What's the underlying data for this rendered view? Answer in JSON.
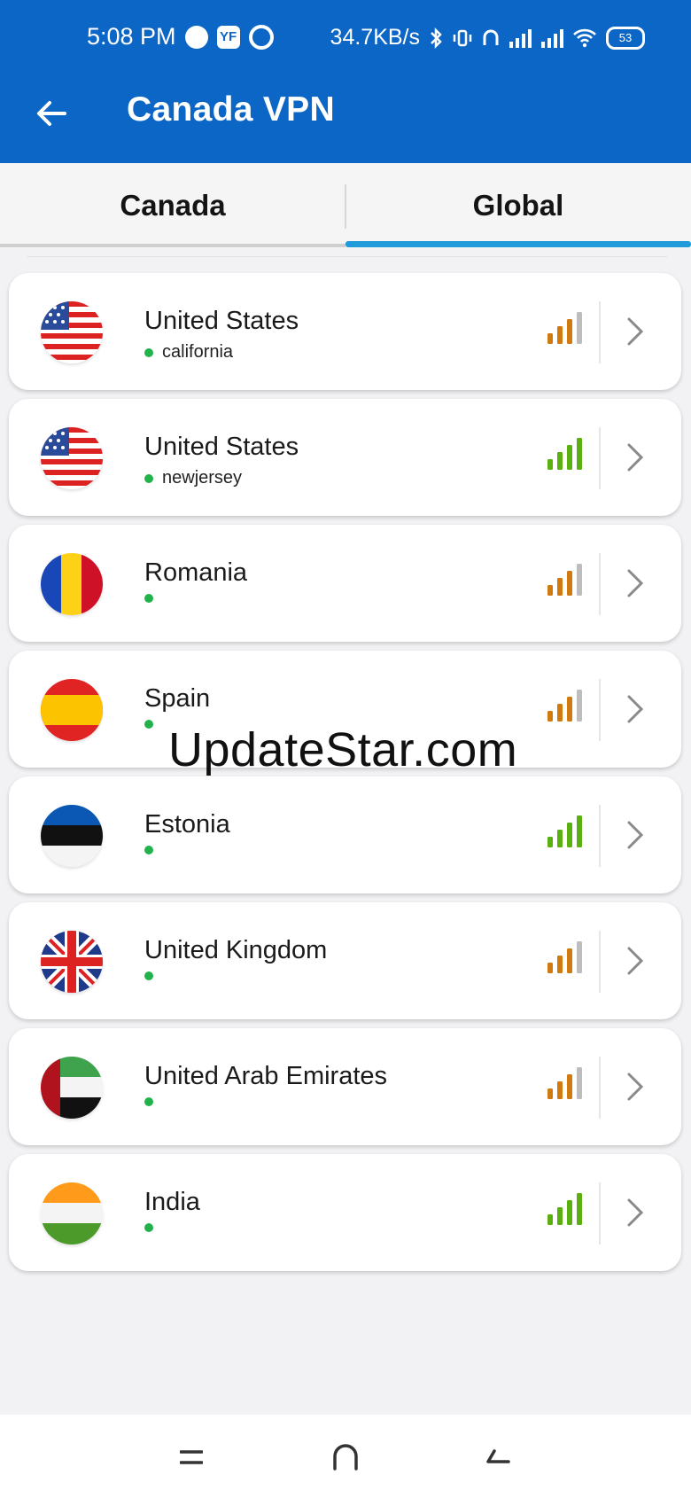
{
  "status_bar": {
    "time": "5:08 PM",
    "app_badge": "YF",
    "net_speed": "34.7KB/s",
    "battery": "53"
  },
  "app_bar": {
    "title": "Canada VPN"
  },
  "tabs": [
    {
      "label": "Canada",
      "active": false
    },
    {
      "label": "Global",
      "active": true
    }
  ],
  "servers": [
    {
      "country": "United States",
      "city": "california",
      "flag": "us-flag-icon",
      "signal_color": "#d07a10"
    },
    {
      "country": "United States",
      "city": "newjersey",
      "flag": "us-flag-icon",
      "signal_color": "#5ab00e"
    },
    {
      "country": "Romania",
      "city": "",
      "flag": "romania-flag-icon",
      "signal_color": "#d07a10"
    },
    {
      "country": "Spain",
      "city": "",
      "flag": "spain-flag-icon",
      "signal_color": "#d07a10"
    },
    {
      "country": "Estonia",
      "city": "",
      "flag": "estonia-flag-icon",
      "signal_color": "#5ab00e"
    },
    {
      "country": "United Kingdom",
      "city": "",
      "flag": "uk-flag-icon",
      "signal_color": "#d07a10"
    },
    {
      "country": "United Arab Emirates",
      "city": "",
      "flag": "uae-flag-icon",
      "signal_color": "#d07a10"
    },
    {
      "country": "India",
      "city": "",
      "flag": "india-flag-icon",
      "signal_color": "#5ab00e"
    }
  ],
  "watermark": "UpdateStar.com"
}
